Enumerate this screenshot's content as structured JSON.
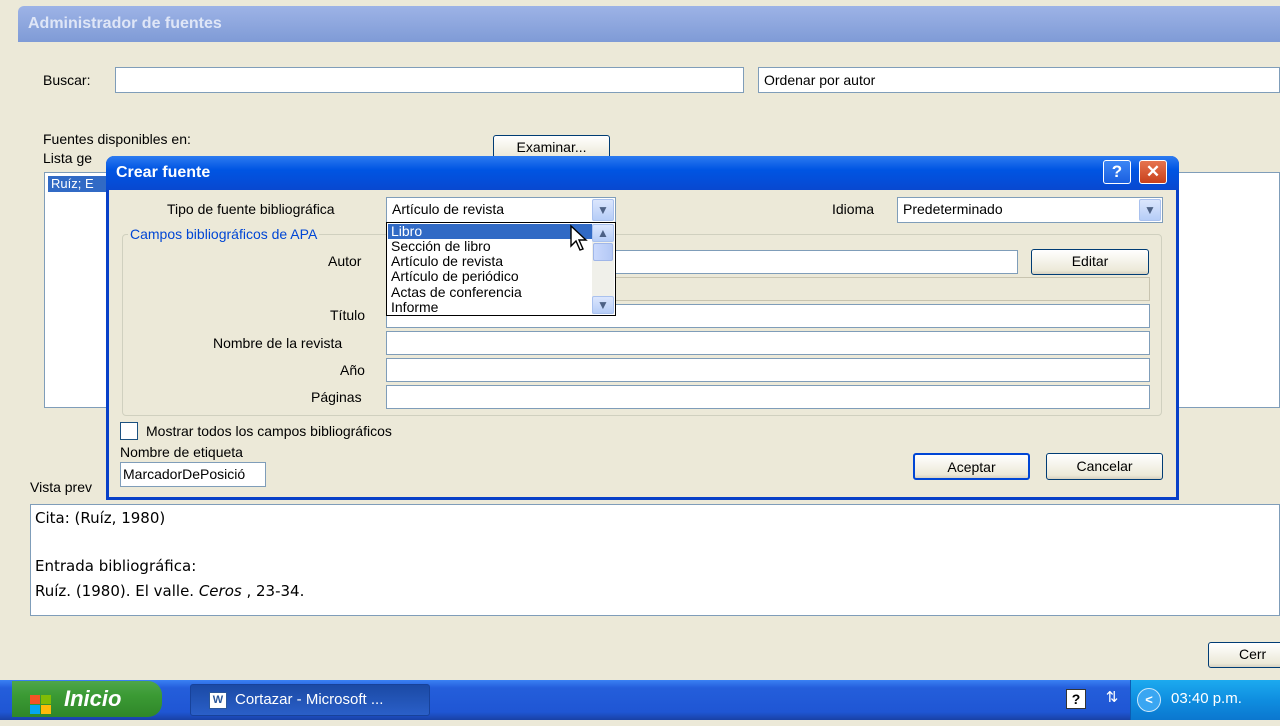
{
  "background_window": {
    "title": "Administrador de fuentes",
    "search_label": "Buscar:",
    "search_value": "",
    "sort_value": "Ordenar por autor",
    "available_label": "Fuentes disponibles en:",
    "list_label": "Lista ge",
    "browse_button": "Examinar...",
    "list_item": "Ruíz; E",
    "preview_label": "Vista prev",
    "preview": {
      "cita": "Cita:  (Ruíz, 1980)",
      "entrada_label": "Entrada bibliográfica:",
      "entrada_text": "Ruíz. (1980). El valle. ",
      "entrada_italic": "Ceros",
      "entrada_end": " , 23-34."
    },
    "close_button": "Cerr"
  },
  "dialog": {
    "title": "Crear fuente",
    "help_glyph": "?",
    "close_glyph": "✕",
    "type_label": "Tipo de fuente bibliográfica",
    "type_value": "Artículo de revista",
    "language_label": "Idioma",
    "language_value": "Predeterminado",
    "group_label": "Campos bibliográficos de APA",
    "author_label": "Autor",
    "edit_button": "Editar",
    "title_label": "Título",
    "journal_label": "Nombre de la revista",
    "year_label": "Año",
    "pages_label": "Páginas",
    "show_all_label": "Mostrar todos los campos bibliográficos",
    "show_all_checked": false,
    "tag_label": "Nombre de etiqueta",
    "tag_value": "MarcadorDePosició",
    "ok_button": "Aceptar",
    "cancel_button": "Cancelar",
    "dropdown_options": [
      "Libro",
      "Sección de libro",
      "Artículo de revista",
      "Artículo de periódico",
      "Actas de conferencia",
      "Informe"
    ],
    "dropdown_selected": "Libro"
  },
  "taskbar": {
    "start_label": "Inicio",
    "task_label": "Cortazar - Microsoft ...",
    "clock": "03:40 p.m."
  },
  "colors": {
    "dialog_title": "#0055e3",
    "selection": "#316ac5",
    "taskbar": "#245edb",
    "start_button": "#3b9a34"
  }
}
